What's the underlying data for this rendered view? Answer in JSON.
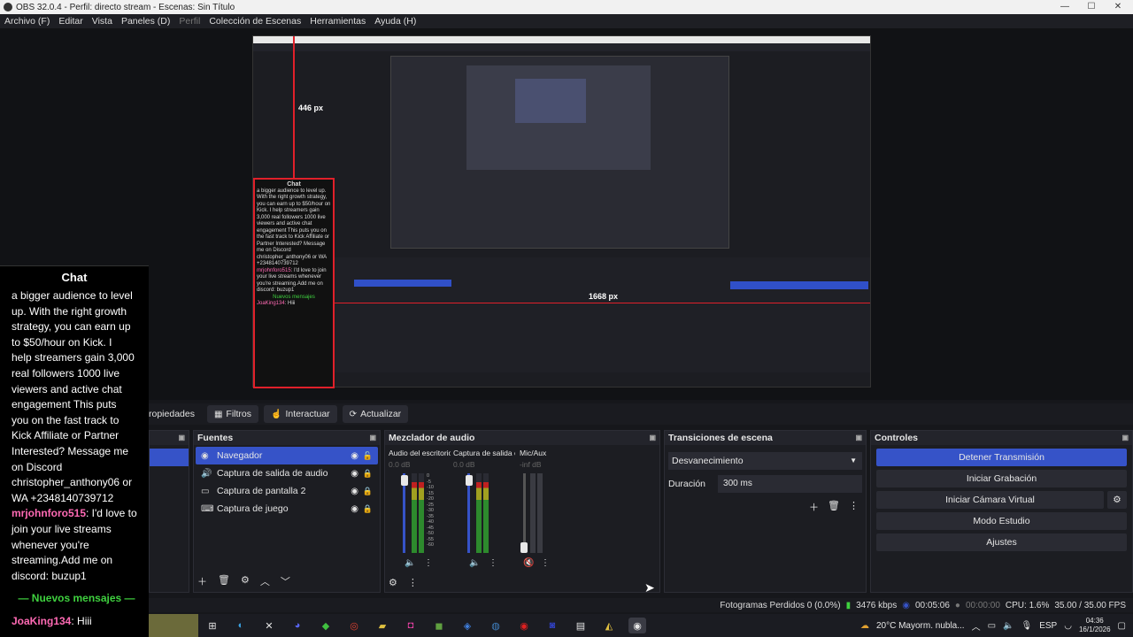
{
  "window": {
    "title": "OBS 32.0.4 - Perfil: directo stream - Escenas: Sin Título",
    "min": "—",
    "max": "☐",
    "close": "✕"
  },
  "menu": [
    "Archivo (F)",
    "Editar",
    "Vista",
    "Paneles (D)",
    "Perfil",
    "Colección de Escenas",
    "Herramientas",
    "Ayuda (H)"
  ],
  "preview": {
    "px_top": "446 px",
    "px_right": "1668 px",
    "chat_title": "Chat",
    "nested_chat": "a bigger audience to level up. With the right growth strategy, you can earn up to $50/hour on Kick. I help streamers gain 3,000 real followers 1000 live viewers and active chat engagement This puts you on the fast track to Kick Affiliate or Partner Interested? Message me on Discord christopher_anthony06 or WA +2348140739712",
    "nested_user": "mrjohnforo515",
    "nested_msg": ": I'd love to join your live streams whenever you're streaming.Add me on discord: buzup1",
    "nested_nuevos": "Nuevos mensajes",
    "nested_last_user": "JoaKing134",
    "nested_last_msg": ": Hiii"
  },
  "chat": {
    "title": "Chat",
    "lines": [
      "a bigger audience to level",
      "up. With the right growth",
      "strategy, you can earn up",
      "to $50/hour on Kick. I",
      "help streamers gain 3,000",
      "real followers 1000 live",
      "viewers and active chat",
      "engagement This puts",
      "you on the fast track to",
      "Kick Affiliate or Partner",
      "Interested? Message me",
      "on Discord",
      "christopher_anthony06 or",
      "WA +2348140739712"
    ],
    "user2": "mrjohnforo515",
    "msg2_first": ": I'd love to",
    "msg2_lines": [
      "join your live streams",
      "whenever you're",
      "streaming.Add me on",
      "discord: buzup1"
    ],
    "nuevos": "— Nuevos mensajes —",
    "last_user": "JoaKing134",
    "last_msg": ": Hiii"
  },
  "toolbar": {
    "propiedades": "ropiedades",
    "filtros": "Filtros",
    "interactuar": "Interactuar",
    "actualizar": "Actualizar"
  },
  "fuentes": {
    "title": "Fuentes",
    "items": [
      "Navegador",
      "Captura de salida de audio",
      "Captura de pantalla 2",
      "Captura de juego"
    ]
  },
  "mixer": {
    "title": "Mezclador de audio",
    "channels": [
      {
        "name": "Audio del escritorio",
        "db": "0.0 dB"
      },
      {
        "name": "Captura de salida c",
        "db": "0.0 dB"
      },
      {
        "name": "Mic/Aux",
        "db": "-inf dB"
      }
    ],
    "scale": [
      "0",
      "-5",
      "-10",
      "-15",
      "-20",
      "-25",
      "-30",
      "-35",
      "-40",
      "-45",
      "-50",
      "-55",
      "-60"
    ]
  },
  "transitions": {
    "title": "Transiciones de escena",
    "selected": "Desvanecimiento",
    "duration_label": "Duración",
    "duration_value": "300 ms"
  },
  "controls": {
    "title": "Controles",
    "buttons": [
      "Detener Transmisión",
      "Iniciar Grabación",
      "Iniciar Cámara Virtual",
      "Modo Estudio",
      "Ajustes"
    ]
  },
  "status": {
    "dropped": "Fotogramas Perdidos 0 (0.0%)",
    "kbps": "3476 kbps",
    "stream_time": "00:05:06",
    "rec_time": "00:00:00",
    "cpu": "CPU: 1.6%",
    "fps": "35.00 / 35.00 FPS"
  },
  "taskbar": {
    "weather": "20°C  Mayorm. nubla...",
    "lang": "ESP",
    "time": "04:36",
    "date": "16/1/2026"
  },
  "colors": {
    "accent": "#3653c8",
    "red_guide": "#e0202a",
    "green": "#3fd13f",
    "pink": "#ff6ab4"
  }
}
